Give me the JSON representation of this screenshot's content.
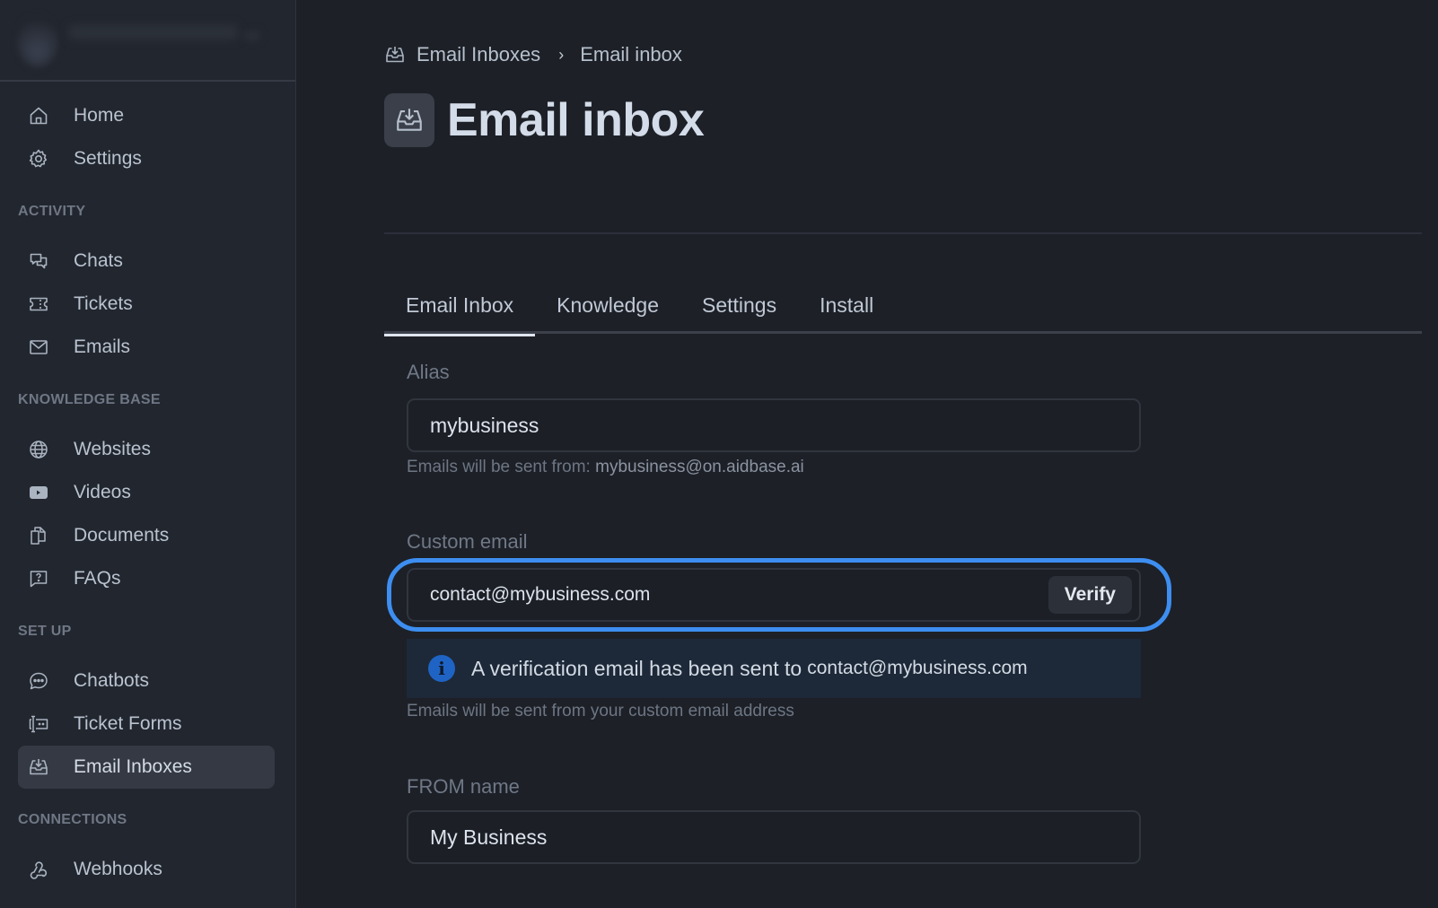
{
  "sidebar": {
    "top_items": [
      {
        "label": "Home",
        "icon": "home-icon"
      },
      {
        "label": "Settings",
        "icon": "gear-icon"
      }
    ],
    "sections": [
      {
        "title": "ACTIVITY",
        "items": [
          {
            "label": "Chats",
            "icon": "chat-bubbles-icon"
          },
          {
            "label": "Tickets",
            "icon": "ticket-icon"
          },
          {
            "label": "Emails",
            "icon": "envelope-icon"
          }
        ]
      },
      {
        "title": "KNOWLEDGE BASE",
        "items": [
          {
            "label": "Websites",
            "icon": "globe-icon"
          },
          {
            "label": "Videos",
            "icon": "play-video-icon"
          },
          {
            "label": "Documents",
            "icon": "documents-icon"
          },
          {
            "label": "FAQs",
            "icon": "question-bubble-icon"
          }
        ]
      },
      {
        "title": "SET UP",
        "items": [
          {
            "label": "Chatbots",
            "icon": "chatbot-icon"
          },
          {
            "label": "Ticket Forms",
            "icon": "form-icon"
          },
          {
            "label": "Email Inboxes",
            "icon": "inbox-icon",
            "active": true
          }
        ]
      },
      {
        "title": "CONNECTIONS",
        "items": [
          {
            "label": "Webhooks",
            "icon": "webhook-icon"
          }
        ]
      }
    ]
  },
  "breadcrumb": {
    "parent": "Email Inboxes",
    "separator": "›",
    "current": "Email inbox"
  },
  "header": {
    "title": "Email inbox"
  },
  "tabs": [
    {
      "label": "Email Inbox",
      "active": true
    },
    {
      "label": "Knowledge"
    },
    {
      "label": "Settings"
    },
    {
      "label": "Install"
    }
  ],
  "form": {
    "alias": {
      "label": "Alias",
      "value": "mybusiness",
      "help_prefix": "Emails will be sent from:",
      "help_value": "mybusiness@on.aidbase.ai"
    },
    "custom_email": {
      "label": "Custom email",
      "value": "contact@mybusiness.com",
      "verify_label": "Verify",
      "alert_text": "A verification email has been sent to",
      "alert_email": "contact@mybusiness.com",
      "help": "Emails will be sent from your custom email address"
    },
    "from_name": {
      "label": "FROM name",
      "value": "My Business"
    }
  },
  "colors": {
    "accent_focus": "#3d8ef0",
    "info_blue": "#1f64c4",
    "background": "#1d2027",
    "sidebar_bg": "#22262e"
  }
}
